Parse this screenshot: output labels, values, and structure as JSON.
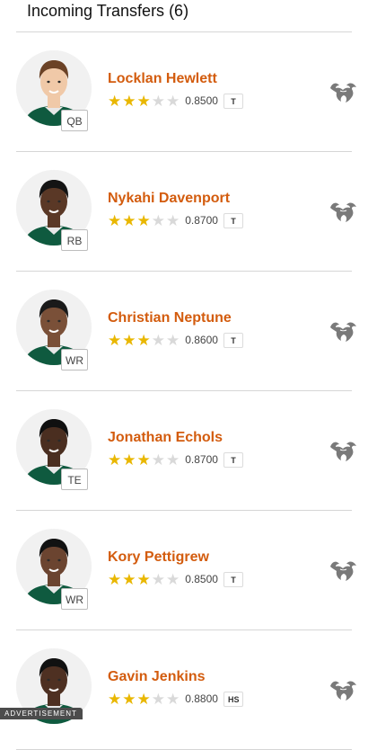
{
  "header": {
    "title": "Incoming Transfers (6)"
  },
  "colors": {
    "name": "#d35c0e",
    "star_on": "#e9b700",
    "star_off": "#d9d9d9",
    "jersey": "#0f5a3f",
    "bull_logo": "#7a7a7a"
  },
  "players": [
    {
      "name": "Locklan Hewlett",
      "position": "QB",
      "stars": 3,
      "max_stars": 5,
      "rating": "0.8500",
      "type": "T",
      "skin": "#f0c9a8",
      "hair": "#6b4226",
      "icon": "usf-bull-logo-icon"
    },
    {
      "name": "Nykahi Davenport",
      "position": "RB",
      "stars": 3,
      "max_stars": 5,
      "rating": "0.8700",
      "type": "T",
      "skin": "#5a3826",
      "hair": "#141414",
      "icon": "usf-bull-logo-icon"
    },
    {
      "name": "Christian Neptune",
      "position": "WR",
      "stars": 3,
      "max_stars": 5,
      "rating": "0.8600",
      "type": "T",
      "skin": "#7a5038",
      "hair": "#1a1a1a",
      "icon": "usf-bull-logo-icon"
    },
    {
      "name": "Jonathan Echols",
      "position": "TE",
      "stars": 3,
      "max_stars": 5,
      "rating": "0.8700",
      "type": "T",
      "skin": "#4a2e20",
      "hair": "#101010",
      "icon": "usf-bull-logo-icon"
    },
    {
      "name": "Kory Pettigrew",
      "position": "WR",
      "stars": 3,
      "max_stars": 5,
      "rating": "0.8500",
      "type": "T",
      "skin": "#6b4430",
      "hair": "#121212",
      "icon": "usf-bull-logo-icon"
    },
    {
      "name": "Gavin Jenkins",
      "position": "",
      "stars": 3,
      "max_stars": 5,
      "rating": "0.8800",
      "type": "HS",
      "skin": "#4e3022",
      "hair": "#111111",
      "icon": "usf-bull-logo-icon"
    }
  ],
  "ad": {
    "label": "ADVERTISEMENT"
  }
}
